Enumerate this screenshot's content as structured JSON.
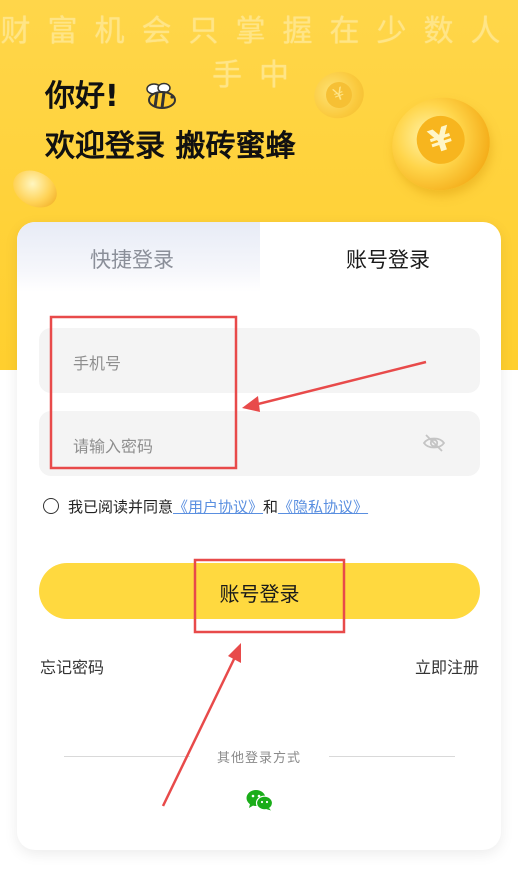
{
  "hero": {
    "slogan": "财富机会只掌握在少数人手中",
    "greeting": "你好!",
    "welcome": "欢迎登录 搬砖蜜蜂",
    "coin_symbol": "¥"
  },
  "tabs": {
    "quick_login": "快捷登录",
    "account_login": "账号登录",
    "active": "account_login"
  },
  "form": {
    "phone_placeholder": "手机号",
    "password_placeholder": "请输入密码",
    "agreement_prefix": "我已阅读并同意",
    "user_agreement": "《用户协议》",
    "agreement_and": "和",
    "privacy_agreement": "《隐私协议》",
    "agreement_checked": false,
    "login_button": "账号登录"
  },
  "links": {
    "forgot_password": "忘记密码",
    "register": "立即注册"
  },
  "other_login": {
    "label": "其他登录方式",
    "methods": [
      "wechat-icon"
    ]
  },
  "colors": {
    "brand_yellow": "#ffd93f",
    "link_blue": "#5a8fe0",
    "annotation_red": "#e84a4a",
    "wechat_green": "#1aad19"
  }
}
